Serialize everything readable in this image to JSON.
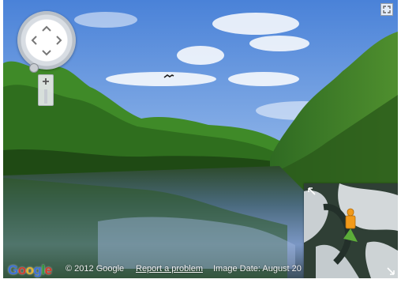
{
  "footer": {
    "logo_letters": [
      "G",
      "o",
      "o",
      "g",
      "l",
      "e"
    ],
    "copyright": "© 2012 Google",
    "report_link": "Report a problem",
    "image_date": "Image Date: August 20"
  },
  "colors": {
    "logo_blue": "#3b6fd8",
    "logo_red": "#d43a2c",
    "logo_yellow": "#e8b32a",
    "logo_green": "#2f9a3c",
    "pegman_orange": "#f29a1a"
  },
  "icons": {
    "pan_up": "chevron-up-icon",
    "pan_down": "chevron-down-icon",
    "pan_left": "chevron-left-icon",
    "pan_right": "chevron-right-icon",
    "zoom_in": "plus-icon",
    "fullscreen": "fullscreen-icon",
    "minimap_expand": "expand-arrow-icon",
    "minimap_resize": "resize-arrow-icon",
    "pegman": "pegman-icon"
  }
}
